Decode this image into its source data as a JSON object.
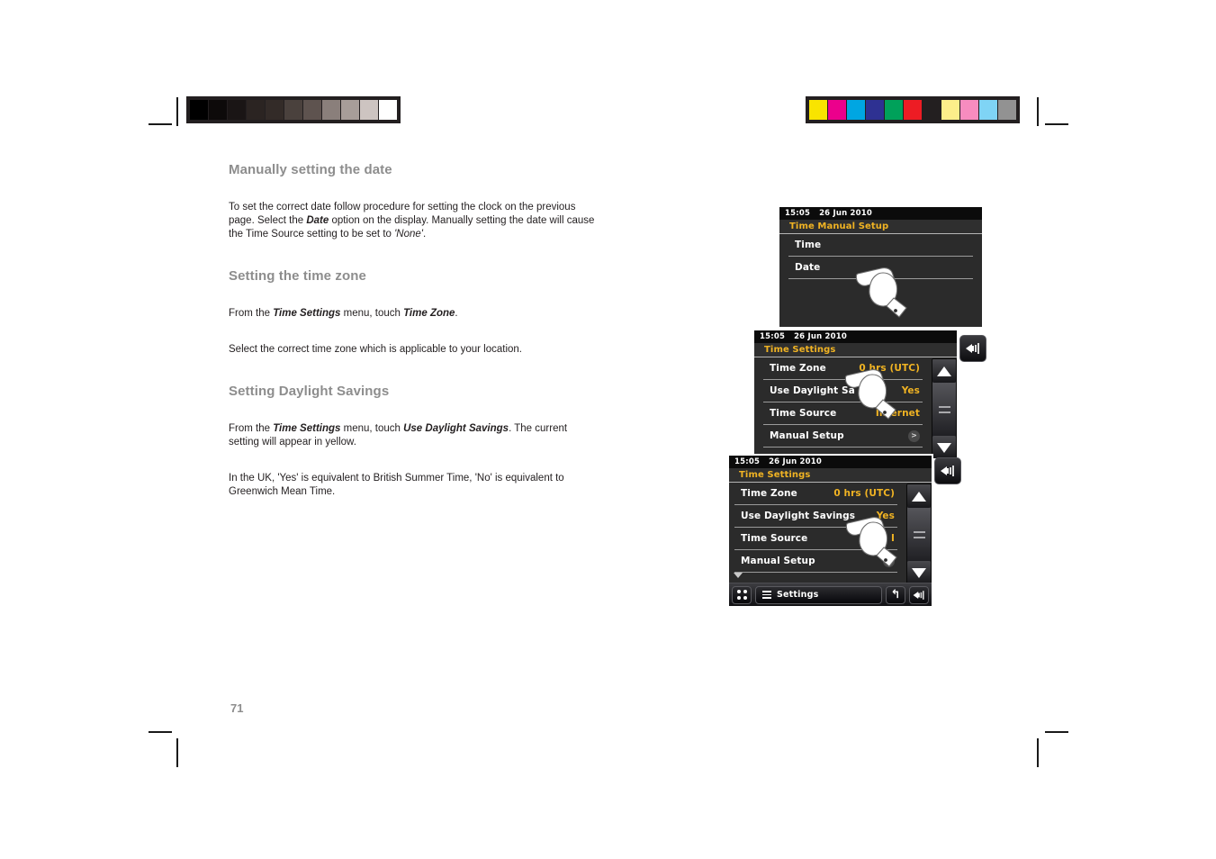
{
  "page": {
    "number": "71"
  },
  "calibration": {
    "gray_label": "grayscale-calibration-strip",
    "gray_swatches": [
      "#000000",
      "#0d0a0a",
      "#1a1515",
      "#2b2422",
      "#332b28",
      "#4a413d",
      "#5e534f",
      "#8a7f7b",
      "#a79d99",
      "#cdc4c1",
      "#ffffff"
    ],
    "color_label": "color-calibration-strip",
    "color_swatches": [
      "#f9e400",
      "#ec008c",
      "#00a6e2",
      "#2e3192",
      "#00a15a",
      "#ed1c24",
      "#231f20",
      "#fcee8a",
      "#f78cbf",
      "#7fd4f5",
      "#929292"
    ]
  },
  "sections": [
    {
      "heading": "Manually setting the date",
      "paragraphs": [
        {
          "runs": [
            {
              "t": "To set the correct date follow procedure for setting the clock on the previous page. Select the ",
              "s": "normal"
            },
            {
              "t": "Date",
              "s": "bold-italic"
            },
            {
              "t": " option on the display. Manually setting the date will cause the Time Source setting to be set to ",
              "s": "normal"
            },
            {
              "t": "'None'",
              "s": "italic"
            },
            {
              "t": ".",
              "s": "normal"
            }
          ]
        }
      ]
    },
    {
      "heading": "Setting the time zone",
      "paragraphs": [
        {
          "runs": [
            {
              "t": "From the ",
              "s": "normal"
            },
            {
              "t": "Time Settings",
              "s": "bold-italic"
            },
            {
              "t": " menu, touch ",
              "s": "normal"
            },
            {
              "t": "Time Zone",
              "s": "bold-italic"
            },
            {
              "t": ".",
              "s": "normal"
            }
          ]
        },
        {
          "runs": [
            {
              "t": "Select the correct time zone which is applicable to your location.",
              "s": "normal"
            }
          ]
        }
      ]
    },
    {
      "heading": "Setting Daylight Savings",
      "paragraphs": [
        {
          "runs": [
            {
              "t": "From the ",
              "s": "normal"
            },
            {
              "t": "Time Settings",
              "s": "bold-italic"
            },
            {
              "t": " menu, touch  ",
              "s": "normal"
            },
            {
              "t": "Use Daylight Savings",
              "s": "bold-italic"
            },
            {
              "t": ". The current setting will appear in yellow.",
              "s": "normal"
            }
          ]
        },
        {
          "runs": [
            {
              "t": "In the UK, 'Yes' is equivalent to British Summer Time, 'No' is equivalent to Greenwich Mean Time.",
              "s": "normal"
            }
          ]
        }
      ]
    }
  ],
  "screens": {
    "accent_yellow": "#f0b323",
    "screen1": {
      "status": {
        "time": "15:05",
        "date": "26 Jun 2010"
      },
      "title": "Time Manual Setup",
      "rows": [
        {
          "label": "Time",
          "value": ""
        },
        {
          "label": "Date",
          "value": ""
        }
      ]
    },
    "screen2": {
      "status": {
        "time": "15:05",
        "date": "26 Jun 2010"
      },
      "title": "Time Settings",
      "rows": [
        {
          "label": "Time Zone",
          "value": "0 hrs (UTC)"
        },
        {
          "label": "Use Daylight Sa",
          "value": "Yes"
        },
        {
          "label": "Time Source",
          "value": "Internet"
        },
        {
          "label": "Manual Setup",
          "value": ">"
        }
      ],
      "volume_icon": "speaker-volume-icon"
    },
    "screen3": {
      "status": {
        "time": "15:05",
        "date": "26 Jun 2010"
      },
      "title": "Time Settings",
      "rows": [
        {
          "label": "Time Zone",
          "value": "0 hrs (UTC)"
        },
        {
          "label": "Use Daylight Savings",
          "value": "Yes"
        },
        {
          "label": "Time Source",
          "value": "I"
        },
        {
          "label": "Manual Setup",
          "value": ">"
        }
      ],
      "volume_icon": "speaker-volume-icon",
      "toolbar": {
        "grid_icon": "grid-apps-icon",
        "menu_icon": "hamburger-menu-icon",
        "menu_label": "Settings",
        "back_icon": "back-arrow-icon",
        "volume_icon": "speaker-volume-icon"
      }
    }
  }
}
